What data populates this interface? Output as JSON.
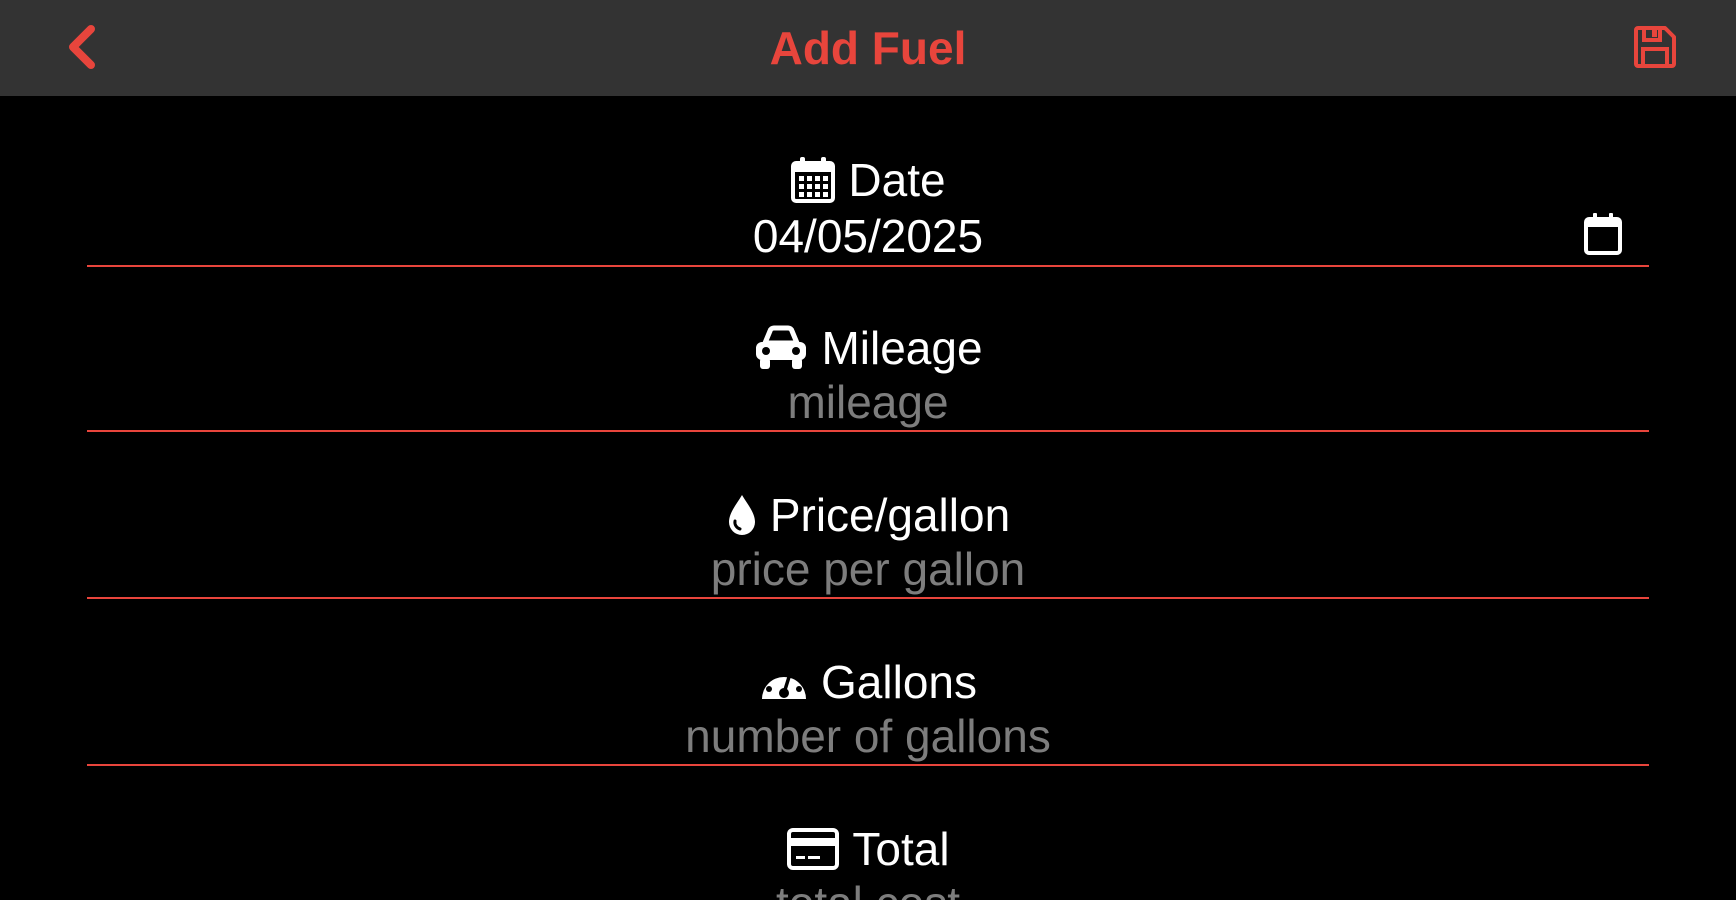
{
  "header": {
    "title": "Add Fuel",
    "back_icon": "chevron-left-icon",
    "save_icon": "floppy-disk-icon",
    "accent_color": "#e8453c",
    "background_color": "#333333"
  },
  "form": {
    "date": {
      "label": "Date",
      "icon": "calendar-icon",
      "value": "04/05/2025",
      "picker_icon": "calendar-picker-icon"
    },
    "mileage": {
      "label": "Mileage",
      "icon": "car-icon",
      "placeholder": "mileage",
      "value": ""
    },
    "price": {
      "label": "Price/gallon",
      "icon": "droplet-icon",
      "placeholder": "price per gallon",
      "value": ""
    },
    "gallons": {
      "label": "Gallons",
      "icon": "gauge-icon",
      "placeholder": "number of gallons",
      "value": ""
    },
    "total": {
      "label": "Total",
      "icon": "credit-card-icon",
      "placeholder": "total cost",
      "value": ""
    }
  }
}
